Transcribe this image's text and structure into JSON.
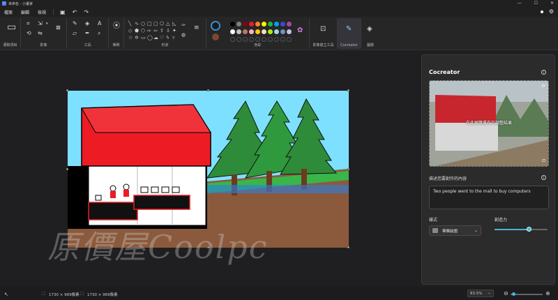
{
  "titlebar": {
    "title": "未命名 - 小畫家",
    "minimize": "—",
    "maximize": "☐",
    "close": "✕"
  },
  "menu": {
    "file": "檔案",
    "edit": "編輯",
    "view": "檢視",
    "save_icon": "save-icon",
    "undo_icon": "undo-icon",
    "redo_icon": "redo-icon"
  },
  "ribbon": {
    "select_label": "選取項目",
    "image_label": "影像",
    "tools_label": "工具",
    "brushes_label": "筆刷",
    "shapes_label": "形狀",
    "colors_label": "色彩",
    "image_creator_label": "影像建立工具",
    "cocreator_label": "Cocreator",
    "layers_label": "圖層",
    "colors": [
      "#000000",
      "#7f7f7f",
      "#880015",
      "#ed1c24",
      "#ff7f27",
      "#fff200",
      "#22b14c",
      "#00a2e8",
      "#3f48cc",
      "#a349a4",
      "#ffffff",
      "#c3c3c3",
      "#b97a57",
      "#ffaec9",
      "#ffc90e",
      "#efe4b0",
      "#b5e61d",
      "#99d9ea",
      "#7092be",
      "#c8bfe7",
      "#ffffff",
      "#ffffff",
      "#ffffff",
      "#ffffff",
      "#ffffff",
      "#ffffff",
      "#ffffff",
      "#ffffff",
      "#ffffff",
      "#ffffff"
    ],
    "primary_color": "#1a1a1a",
    "secondary_color": "#7a4a2a"
  },
  "cocreator": {
    "title": "Cocreator",
    "preview_overlay": "在此預覽畫布的調整結果",
    "prompt_label": "描述您要創作的內容",
    "prompt_value": "Two people went to the mall to buy computers",
    "style_label": "樣式",
    "style_value": "筆觸繪圖",
    "creativity_label": "創造力",
    "creativity_value": 0.65
  },
  "watermark": "原價屋Coolpc",
  "status": {
    "pointer_icon": "pointer-icon",
    "selection_size": "1730 × 969像素",
    "canvas_size": "1730 × 969像素",
    "zoom": "83.5%"
  }
}
